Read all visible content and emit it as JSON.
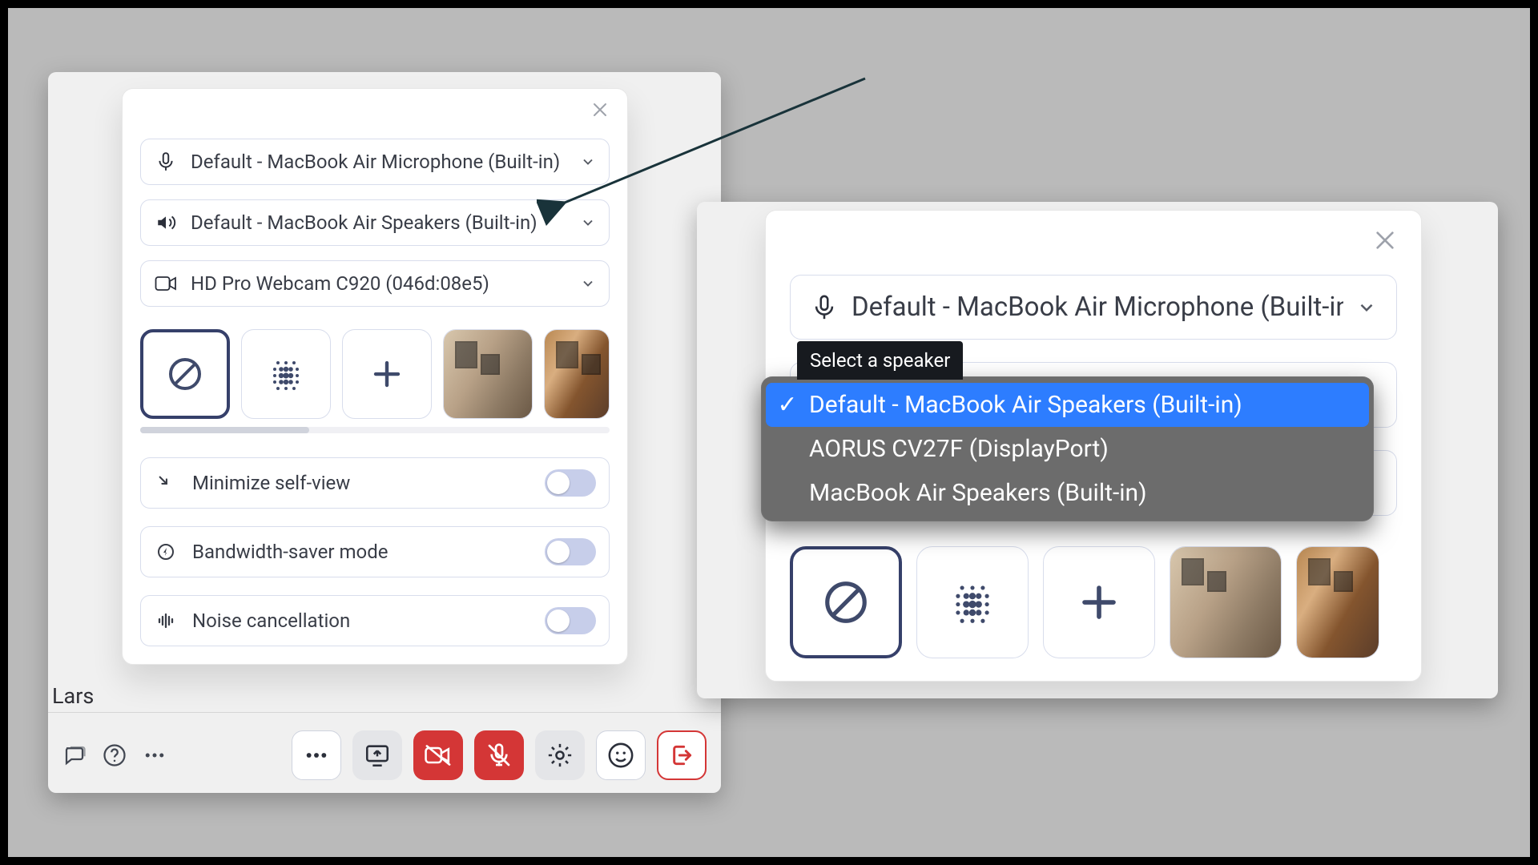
{
  "left": {
    "visible_name": "Lars",
    "popover": {
      "mic": {
        "label": "Default - MacBook Air Microphone (Built-in)"
      },
      "speaker": {
        "label": "Default - MacBook Air Speakers (Built-in)"
      },
      "camera": {
        "label": "HD Pro Webcam C920 (046d:08e5)"
      },
      "toggles": {
        "minimize": {
          "label": "Minimize self-view",
          "on": false
        },
        "bandwidth": {
          "label": "Bandwidth-saver mode",
          "on": false
        },
        "noise": {
          "label": "Noise cancellation",
          "on": false
        }
      }
    }
  },
  "right": {
    "mic": {
      "label": "Default - MacBook Air Microphone (Built-in)"
    },
    "tooltip": "Select a speaker",
    "dropdown": {
      "options": [
        "Default - MacBook Air Speakers (Built-in)",
        "AORUS CV27F (DisplayPort)",
        "MacBook Air Speakers (Built-in)"
      ],
      "selected_index": 0
    }
  }
}
